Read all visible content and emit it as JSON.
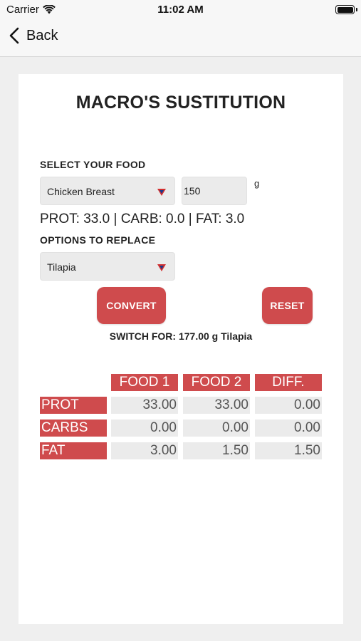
{
  "status_bar": {
    "carrier": "Carrier",
    "time": "11:02 AM"
  },
  "nav": {
    "back_label": "Back"
  },
  "title": "MACRO'S SUSTITUTION",
  "select_food": {
    "label": "SELECT YOUR FOOD",
    "selected": "Chicken Breast",
    "quantity": "150",
    "unit": "g"
  },
  "macros_line": "PROT: 33.0 | CARB: 0.0 | FAT: 3.0",
  "replace": {
    "label": "OPTIONS TO REPLACE",
    "selected": "Tilapia"
  },
  "buttons": {
    "convert": "CONVERT",
    "reset": "RESET"
  },
  "switch_text": "SWITCH FOR: 177.00 g Tilapia",
  "table": {
    "headers": [
      "FOOD 1",
      "FOOD 2",
      "DIFF."
    ],
    "rows": [
      {
        "label": "PROT",
        "values": [
          "33.00",
          "33.00",
          "0.00"
        ]
      },
      {
        "label": "CARBS",
        "values": [
          "0.00",
          "0.00",
          "0.00"
        ]
      },
      {
        "label": "FAT",
        "values": [
          "3.00",
          "1.50",
          "1.50"
        ]
      }
    ]
  },
  "colors": {
    "accent": "#cf4b4d",
    "field_bg": "#ebebeb",
    "page_bg": "#efefef"
  }
}
